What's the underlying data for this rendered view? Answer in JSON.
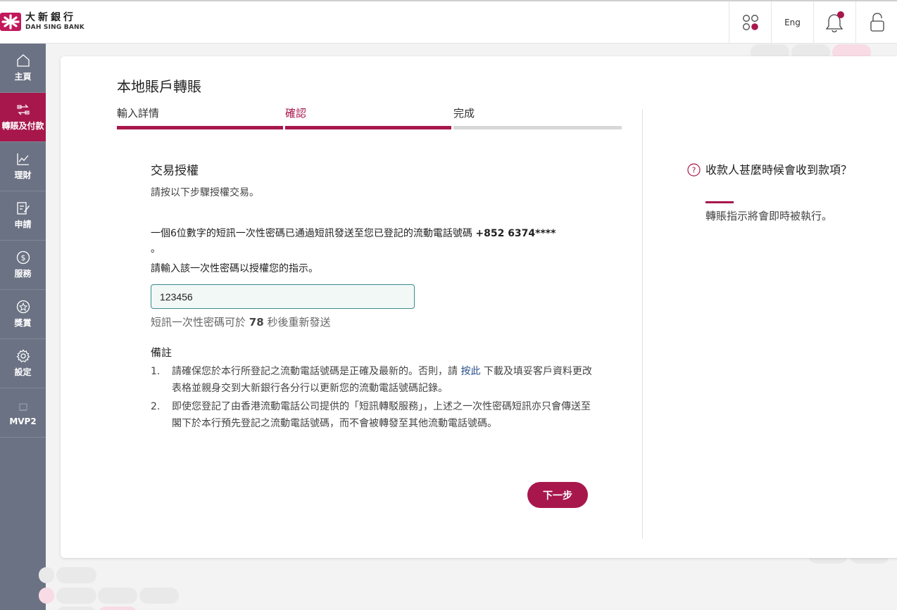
{
  "header": {
    "logo_zh": "大新銀行",
    "logo_en": "DAH SING BANK",
    "lang_label": "Eng"
  },
  "sidebar": {
    "items": [
      {
        "label": "主頁",
        "icon": "home-icon"
      },
      {
        "label": "轉賬及付款",
        "icon": "transfer-icon",
        "active": true
      },
      {
        "label": "理財",
        "icon": "chart-icon"
      },
      {
        "label": "申請",
        "icon": "application-icon"
      },
      {
        "label": "服務",
        "icon": "dollar-icon"
      },
      {
        "label": "獎賞",
        "icon": "star-icon"
      },
      {
        "label": "設定",
        "icon": "gear-icon"
      },
      {
        "label": "MVP2",
        "icon": "mvp-icon"
      }
    ]
  },
  "page": {
    "title": "本地賬戶轉賬",
    "steps": [
      "輸入詳情",
      "確認",
      "完成"
    ],
    "current_step": 2
  },
  "auth": {
    "title": "交易授權",
    "subtitle": "請按以下步驟授權交易。",
    "otp_message": "一個6位數字的短訊一次性密碼已通過短訊發送至您已登記的流動電話號碼",
    "phone": "+852 6374****",
    "otp_message_end": "。",
    "prompt": "請輸入該一次性密碼以授權您的指示。",
    "otp_value": "123456",
    "resend_prefix": "短訊一次性密碼可於",
    "resend_seconds": "78",
    "resend_suffix": "秒後重新發送"
  },
  "notes": {
    "title": "備註",
    "items": [
      {
        "num": "1.",
        "pre": "請確保您於本行所登記之流動電話號碼是正確及最新的。否則，請",
        "link": "按此",
        "post": "下載及填妥客戶資料更改表格並親身交到大新銀行各分行以更新您的流動電話號碼記錄。"
      },
      {
        "num": "2.",
        "text": "即使您登記了由香港流動電話公司提供的「短訊轉駁服務」，上述之一次性密碼短訊亦只會傳送至閣下於本行預先登記之流動電話號碼，而不會被轉發至其他流動電話號碼。"
      }
    ]
  },
  "next_button": "下一步",
  "faq": {
    "question": "收款人甚麼時候會收到款項？",
    "answer": "轉賬指示將會即時被執行。"
  },
  "colors": {
    "brand": "#a8174c",
    "sidebar": "#6b7283",
    "input_border": "#3d8a8e"
  }
}
